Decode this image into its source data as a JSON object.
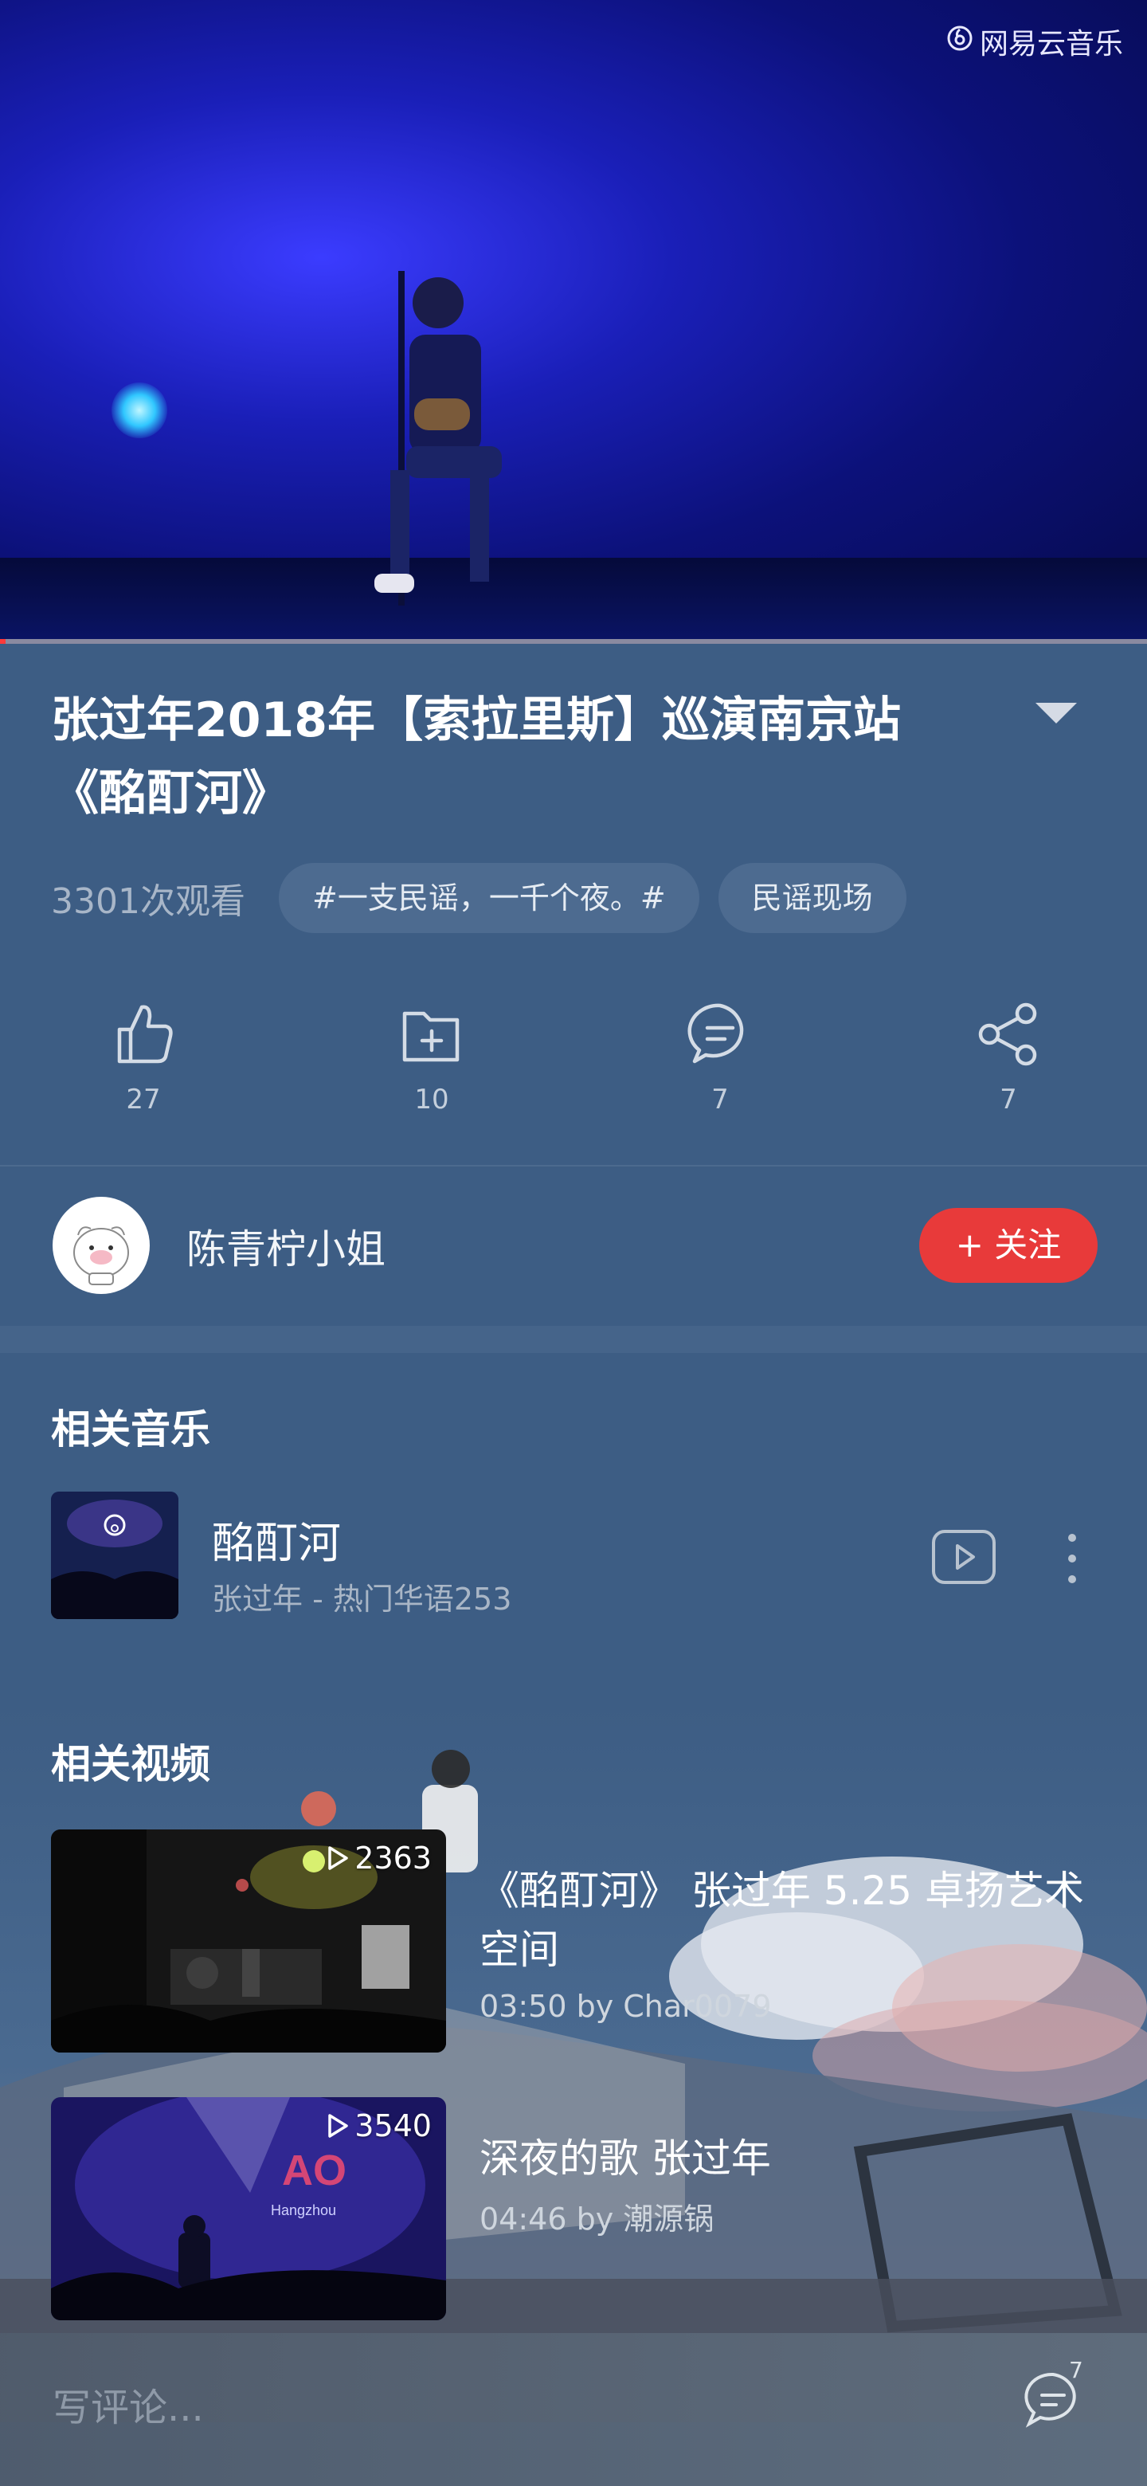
{
  "player": {
    "watermark": "网易云音乐",
    "progress": 0.005
  },
  "video": {
    "title": "张过年2018年【索拉里斯】巡演南京站《酩酊河》",
    "views": "3301次观看",
    "tags": [
      "#一支民谣，一千个夜。#",
      "民谣现场"
    ]
  },
  "actions": {
    "like": "27",
    "collect": "10",
    "comment": "7",
    "share": "7"
  },
  "user": {
    "name": "陈青柠小姐",
    "follow_label": "+ 关注"
  },
  "related_music": {
    "heading": "相关音乐",
    "song": {
      "name": "酩酊河",
      "subtitle": "张过年 - 热门华语253"
    }
  },
  "related_videos": {
    "heading": "相关视频",
    "items": [
      {
        "title": "《酩酊河》 张过年 5.25 卓扬艺术空间",
        "meta": "03:50 by Char0079",
        "plays": "2363"
      },
      {
        "title": "深夜的歌 张过年",
        "meta": "04:46 by 潮源锅",
        "plays": "3540"
      }
    ]
  },
  "comment_bar": {
    "placeholder": "写评论...",
    "count": "7"
  },
  "colors": {
    "background": "#3d5d84",
    "accent_red": "#e83a3a",
    "tag_bg": "#4d6b90"
  }
}
